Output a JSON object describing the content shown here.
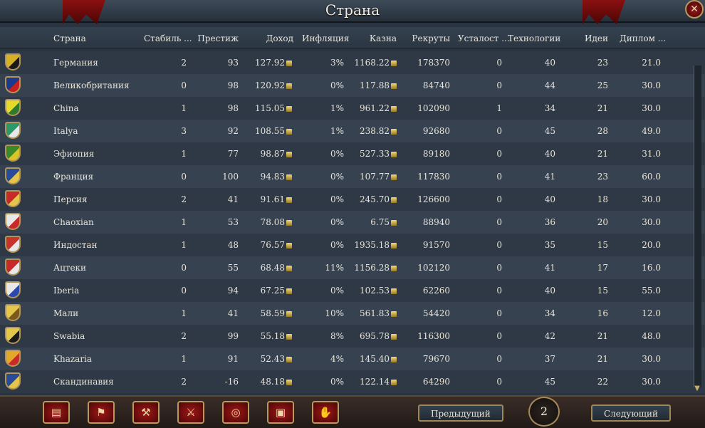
{
  "window": {
    "title": "Страна",
    "close_symbol": "✕"
  },
  "columns": [
    "Страна",
    "Стабиль ...",
    "Престиж",
    "Доход",
    "Инфляция",
    "Казна",
    "Рекруты",
    "Усталост ...",
    "Технологии",
    "Идеи",
    "Диплом ..."
  ],
  "rows": [
    {
      "name": "Германия",
      "stability": "2",
      "prestige": "93",
      "income": "127.92",
      "inflation": "3%",
      "treasury": "1168.22",
      "manpower": "178370",
      "war_weariness": "0",
      "tech": "40",
      "ideas": "23",
      "diplomacy": "21.0",
      "flag_colors": [
        "#d6b125",
        "#1a1a1a"
      ]
    },
    {
      "name": "Великобритания",
      "stability": "0",
      "prestige": "98",
      "income": "120.92",
      "inflation": "0%",
      "treasury": "117.88",
      "manpower": "84740",
      "war_weariness": "0",
      "tech": "44",
      "ideas": "25",
      "diplomacy": "30.0",
      "flag_colors": [
        "#1c3a8c",
        "#c81e1e"
      ]
    },
    {
      "name": "China",
      "stability": "1",
      "prestige": "98",
      "income": "115.05",
      "inflation": "1%",
      "treasury": "961.22",
      "manpower": "102090",
      "war_weariness": "1",
      "tech": "34",
      "ideas": "21",
      "diplomacy": "30.0",
      "flag_colors": [
        "#e5d92a",
        "#2e7a2e"
      ]
    },
    {
      "name": "Italya",
      "stability": "3",
      "prestige": "92",
      "income": "108.55",
      "inflation": "1%",
      "treasury": "238.82",
      "manpower": "92680",
      "war_weariness": "0",
      "tech": "45",
      "ideas": "28",
      "diplomacy": "49.0",
      "flag_colors": [
        "#2a9a6a",
        "#e8e8e8"
      ]
    },
    {
      "name": "Эфиопия",
      "stability": "1",
      "prestige": "77",
      "income": "98.87",
      "inflation": "0%",
      "treasury": "527.33",
      "manpower": "89180",
      "war_weariness": "0",
      "tech": "40",
      "ideas": "21",
      "diplomacy": "31.0",
      "flag_colors": [
        "#3a8a2a",
        "#d8c52a"
      ]
    },
    {
      "name": "Франция",
      "stability": "0",
      "prestige": "100",
      "income": "94.83",
      "inflation": "0%",
      "treasury": "107.77",
      "manpower": "117830",
      "war_weariness": "0",
      "tech": "41",
      "ideas": "23",
      "diplomacy": "60.0",
      "flag_colors": [
        "#2a4a9a",
        "#e3c64a"
      ]
    },
    {
      "name": "Персия",
      "stability": "2",
      "prestige": "41",
      "income": "91.61",
      "inflation": "0%",
      "treasury": "245.70",
      "manpower": "126600",
      "war_weariness": "0",
      "tech": "40",
      "ideas": "18",
      "diplomacy": "30.0",
      "flag_colors": [
        "#c82a2a",
        "#e3c64a"
      ]
    },
    {
      "name": "Chaoxian",
      "stability": "1",
      "prestige": "53",
      "income": "78.08",
      "inflation": "0%",
      "treasury": "6.75",
      "manpower": "88940",
      "war_weariness": "0",
      "tech": "36",
      "ideas": "20",
      "diplomacy": "30.0",
      "flag_colors": [
        "#e8e8e8",
        "#c82a2a"
      ]
    },
    {
      "name": "Индостан",
      "stability": "1",
      "prestige": "48",
      "income": "76.57",
      "inflation": "0%",
      "treasury": "1935.18",
      "manpower": "91570",
      "war_weariness": "0",
      "tech": "35",
      "ideas": "15",
      "diplomacy": "20.0",
      "flag_colors": [
        "#c8342a",
        "#e8e8e8"
      ]
    },
    {
      "name": "Ацтеки",
      "stability": "0",
      "prestige": "55",
      "income": "68.48",
      "inflation": "11%",
      "treasury": "1156.28",
      "manpower": "102120",
      "war_weariness": "0",
      "tech": "41",
      "ideas": "17",
      "diplomacy": "16.0",
      "flag_colors": [
        "#c82a2a",
        "#e8e8e8"
      ]
    },
    {
      "name": "Iberia",
      "stability": "0",
      "prestige": "94",
      "income": "67.25",
      "inflation": "0%",
      "treasury": "102.53",
      "manpower": "62260",
      "war_weariness": "0",
      "tech": "40",
      "ideas": "15",
      "diplomacy": "55.0",
      "flag_colors": [
        "#e8e8e8",
        "#2a4ab0"
      ]
    },
    {
      "name": "Мали",
      "stability": "1",
      "prestige": "41",
      "income": "58.59",
      "inflation": "10%",
      "treasury": "561.83",
      "manpower": "54420",
      "war_weariness": "0",
      "tech": "34",
      "ideas": "16",
      "diplomacy": "12.0",
      "flag_colors": [
        "#e3c64a",
        "#7a5a1a"
      ]
    },
    {
      "name": "Swabia",
      "stability": "2",
      "prestige": "99",
      "income": "55.18",
      "inflation": "8%",
      "treasury": "695.78",
      "manpower": "116300",
      "war_weariness": "0",
      "tech": "42",
      "ideas": "21",
      "diplomacy": "48.0",
      "flag_colors": [
        "#e3c64a",
        "#1a1a1a"
      ]
    },
    {
      "name": "Khazaria",
      "stability": "1",
      "prestige": "91",
      "income": "52.43",
      "inflation": "4%",
      "treasury": "145.40",
      "manpower": "79670",
      "war_weariness": "0",
      "tech": "37",
      "ideas": "21",
      "diplomacy": "30.0",
      "flag_colors": [
        "#e3a82a",
        "#c82a2a"
      ]
    },
    {
      "name": "Скандинавия",
      "stability": "2",
      "prestige": "-16",
      "income": "48.18",
      "inflation": "0%",
      "treasury": "122.14",
      "manpower": "64290",
      "war_weariness": "0",
      "tech": "45",
      "ideas": "22",
      "diplomacy": "30.0",
      "flag_colors": [
        "#2a4a9a",
        "#e3c64a"
      ]
    }
  ],
  "bottom_bar": {
    "buttons": [
      {
        "name": "ledger-icon",
        "glyph": "▤"
      },
      {
        "name": "flag-icon",
        "glyph": "⚑"
      },
      {
        "name": "build-icon",
        "glyph": "⚒"
      },
      {
        "name": "swords-icon",
        "glyph": "⚔"
      },
      {
        "name": "coins-icon",
        "glyph": "◎"
      },
      {
        "name": "trade-icon",
        "glyph": "▣"
      },
      {
        "name": "handshake-icon",
        "glyph": "✋"
      }
    ],
    "prev_label": "Предыдущий",
    "next_label": "Следующий",
    "page": "2"
  },
  "colors": {
    "accent_gold": "#b79a5e",
    "button_red": "#a01818"
  }
}
